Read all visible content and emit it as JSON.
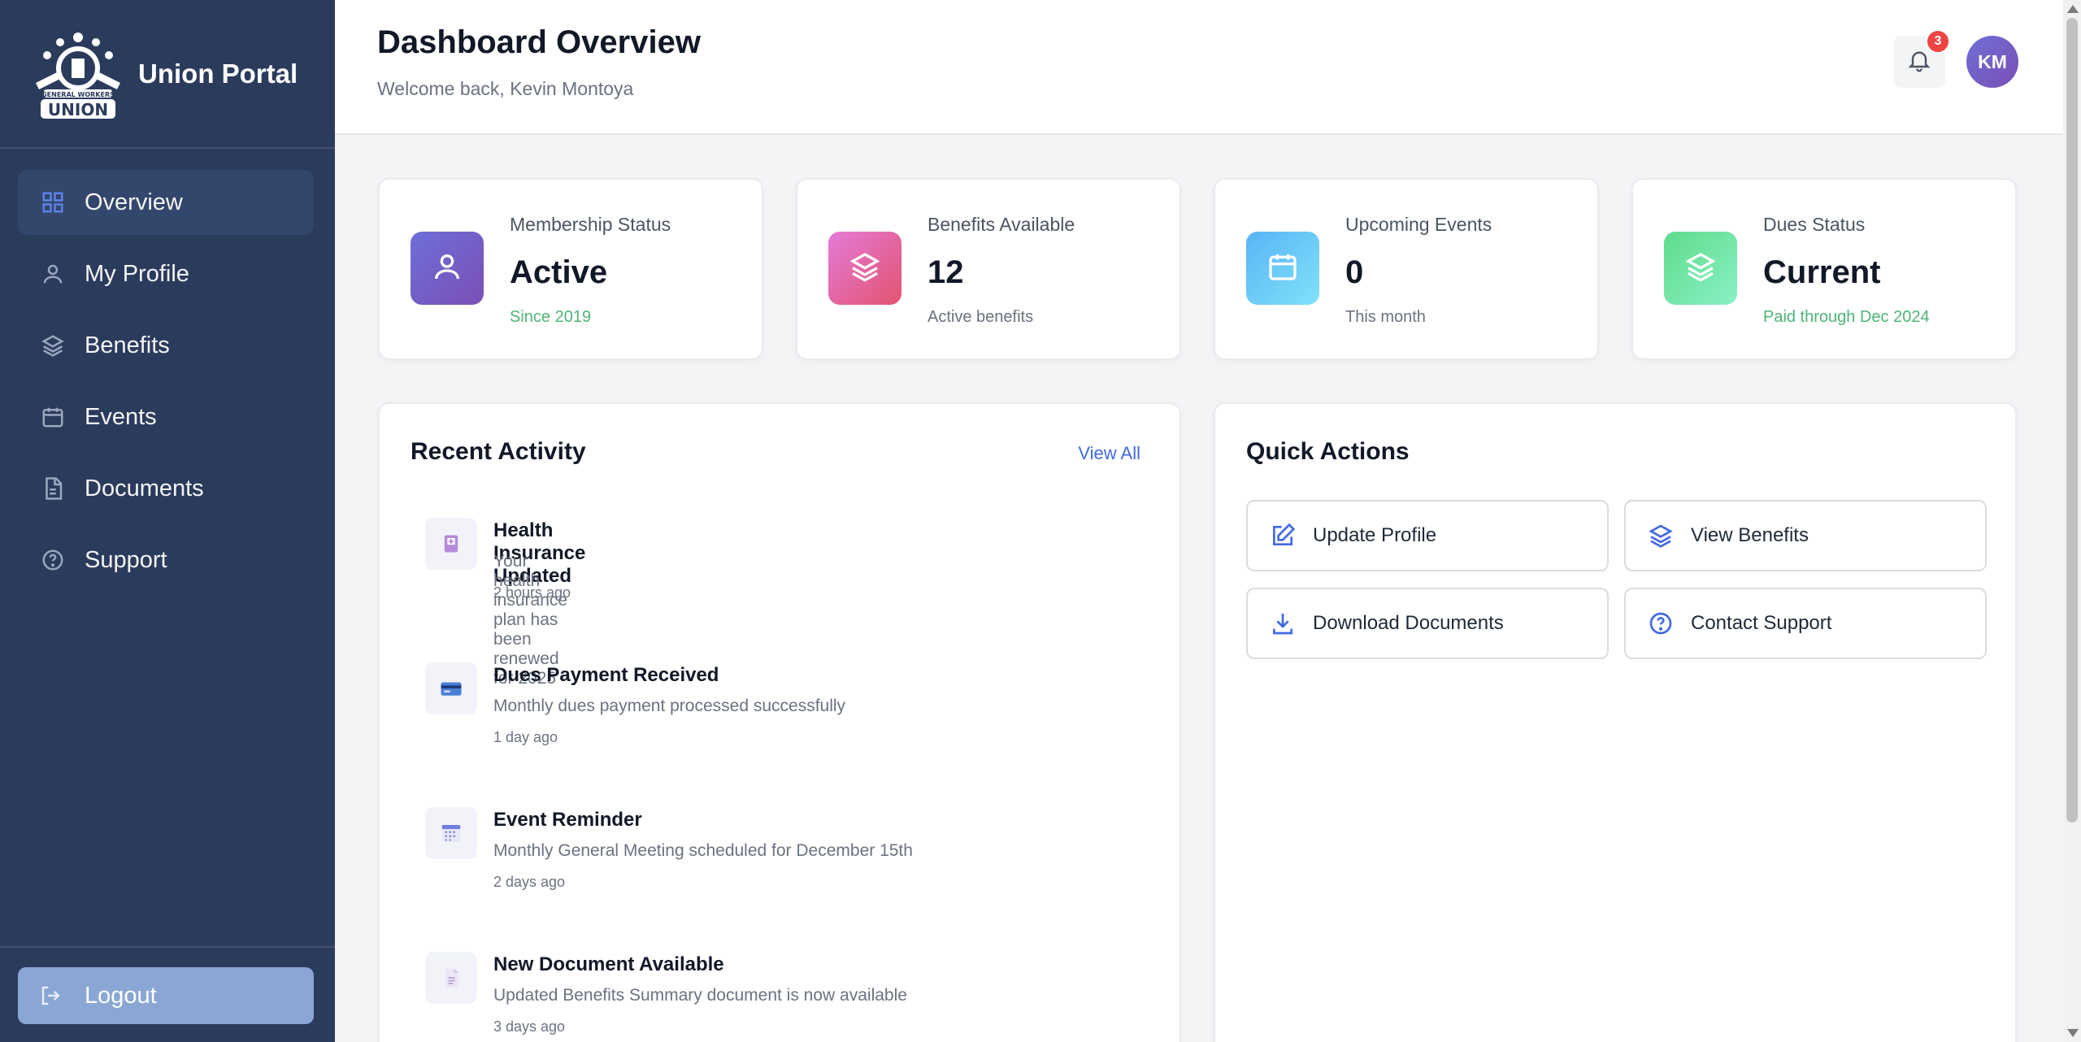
{
  "app": {
    "brand_name": "Union Portal",
    "logo_text_top": "GENERAL WORKERS",
    "logo_text_main": "UNION"
  },
  "sidebar": {
    "items": [
      {
        "label": "Overview",
        "icon": "grid-icon",
        "active": true
      },
      {
        "label": "My Profile",
        "icon": "user-icon",
        "active": false
      },
      {
        "label": "Benefits",
        "icon": "layers-icon",
        "active": false
      },
      {
        "label": "Events",
        "icon": "calendar-icon",
        "active": false
      },
      {
        "label": "Documents",
        "icon": "document-icon",
        "active": false
      },
      {
        "label": "Support",
        "icon": "help-circle-icon",
        "active": false
      }
    ],
    "logout_label": "Logout"
  },
  "header": {
    "title": "Dashboard Overview",
    "welcome": "Welcome back, Kevin Montoya",
    "notification_count": "3",
    "avatar_initials": "KM"
  },
  "stats": [
    {
      "label": "Membership Status",
      "value": "Active",
      "sub": "Since 2019",
      "sub_color": "#4fb477",
      "icon": "user-icon",
      "gradient": [
        "#6d6fd9",
        "#7a4fb5"
      ]
    },
    {
      "label": "Benefits Available",
      "value": "12",
      "sub": "Active benefits",
      "sub_color": "#6b7280",
      "icon": "layers-icon",
      "gradient": [
        "#e47ad9",
        "#e35470"
      ]
    },
    {
      "label": "Upcoming Events",
      "value": "0",
      "sub": "This month",
      "sub_color": "#6b7280",
      "icon": "calendar-icon",
      "gradient": [
        "#5ab3f5",
        "#7fe3fa"
      ]
    },
    {
      "label": "Dues Status",
      "value": "Current",
      "sub": "Paid through Dec 2024",
      "sub_color": "#4fb477",
      "icon": "layers-icon",
      "gradient": [
        "#5fdc8c",
        "#8af0c4"
      ]
    }
  ],
  "recent_activity": {
    "title": "Recent Activity",
    "view_all": "View All",
    "items": [
      {
        "title": "Health Insurance Updated",
        "desc": "Your health insurance plan has been renewed for 2025",
        "time": "2 hours ago",
        "icon": "insurance-card-icon"
      },
      {
        "title": "Dues Payment Received",
        "desc": "Monthly dues payment processed successfully",
        "time": "1 day ago",
        "icon": "credit-card-icon"
      },
      {
        "title": "Event Reminder",
        "desc": "Monthly General Meeting scheduled for December 15th",
        "time": "2 days ago",
        "icon": "calendar-grid-icon"
      },
      {
        "title": "New Document Available",
        "desc": "Updated Benefits Summary document is now available",
        "time": "3 days ago",
        "icon": "document-page-icon"
      }
    ]
  },
  "quick_actions": {
    "title": "Quick Actions",
    "items": [
      {
        "label": "Update Profile",
        "icon": "edit-icon"
      },
      {
        "label": "View Benefits",
        "icon": "layers-icon"
      },
      {
        "label": "Download Documents",
        "icon": "download-icon"
      },
      {
        "label": "Contact Support",
        "icon": "help-circle-icon"
      }
    ]
  },
  "colors": {
    "sidebar_bg": "#2b3b5c",
    "accent": "#4169e1",
    "success": "#4fb477",
    "badge": "#ef4444"
  }
}
